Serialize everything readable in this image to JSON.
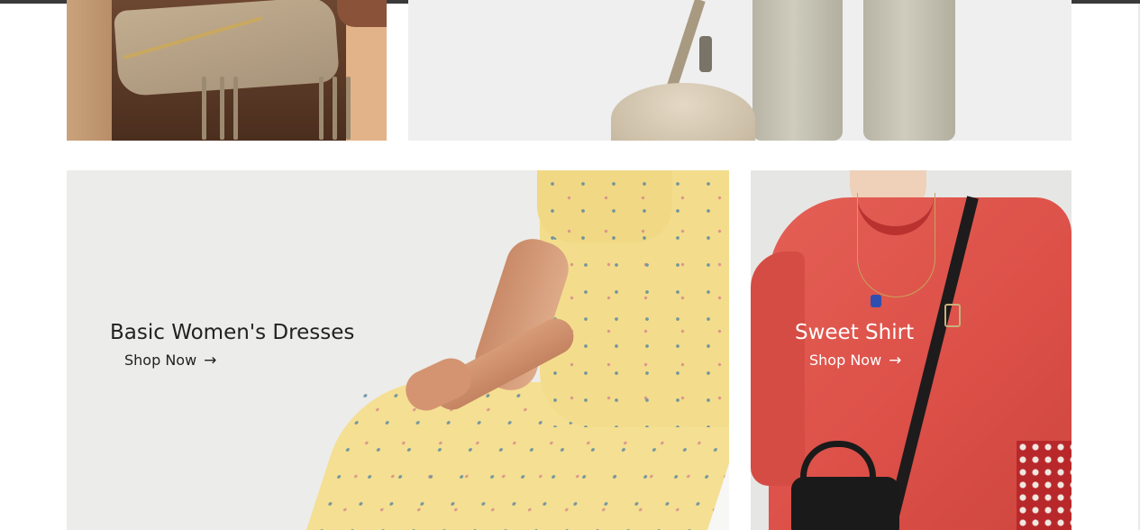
{
  "banners": [
    {
      "title": "Basic Women's Dresses",
      "link_label": "Shop Now",
      "link_icon": "arrow-right-icon",
      "text_color": "#222222"
    },
    {
      "title": "Sweet Shirt",
      "link_label": "Shop Now",
      "link_icon": "arrow-right-icon",
      "text_color": "#ffffff"
    }
  ],
  "images": {
    "top_left": "fringe-bag-photo",
    "top_right": "trousers-bag-photo",
    "bottom_left": "yellow-dress-photo",
    "bottom_right": "coral-sweater-photo"
  },
  "colors": {
    "page_background": "#ffffff",
    "top_bar": "#3a3a3a"
  }
}
